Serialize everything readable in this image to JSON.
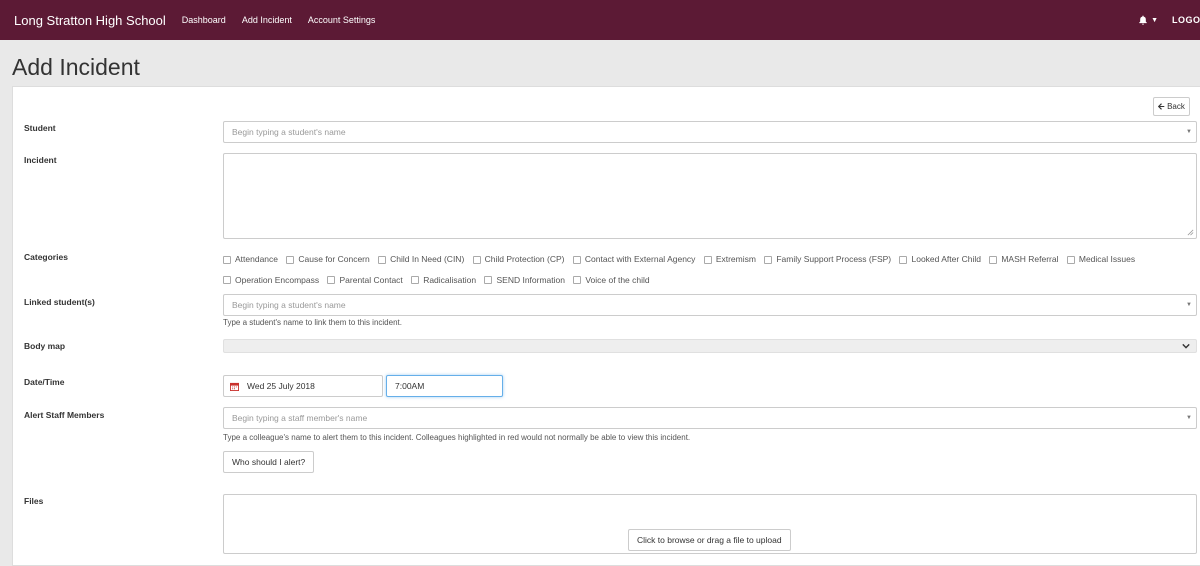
{
  "nav": {
    "brand": "Long Stratton High School",
    "links": [
      "Dashboard",
      "Add Incident",
      "Account Settings"
    ],
    "logout": "LOGOUT",
    "color": "#5c1a35"
  },
  "page": {
    "title": "Add Incident"
  },
  "back": {
    "label": "Back"
  },
  "fields": {
    "student": {
      "label": "Student",
      "placeholder": "Begin typing a student's name"
    },
    "incident": {
      "label": "Incident",
      "value": ""
    },
    "categories": {
      "label": "Categories",
      "options": [
        "Attendance",
        "Cause for Concern",
        "Child In Need (CIN)",
        "Child Protection (CP)",
        "Contact with External Agency",
        "Extremism",
        "Family Support Process (FSP)",
        "Looked After Child",
        "MASH Referral",
        "Medical Issues",
        "Operation Encompass",
        "Parental Contact",
        "Radicalisation",
        "SEND Information",
        "Voice of the child"
      ]
    },
    "linked": {
      "label": "Linked student(s)",
      "placeholder": "Begin typing a student's name",
      "help": "Type a student's name to link them to this incident."
    },
    "bodymap": {
      "label": "Body map"
    },
    "datetime": {
      "label": "Date/Time",
      "date": "Wed 25 July 2018",
      "time": "7:00AM"
    },
    "alert": {
      "label": "Alert Staff Members",
      "placeholder": "Begin typing a staff member's name",
      "help": "Type a colleague's name to alert them to this incident. Colleagues highlighted in red would not normally be able to view this incident.",
      "button": "Who should I alert?"
    },
    "files": {
      "label": "Files",
      "button": "Click to browse or drag a file to upload"
    }
  }
}
